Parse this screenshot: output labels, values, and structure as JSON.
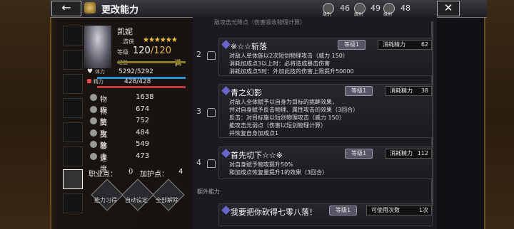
{
  "header": {
    "back_icon": "←",
    "title": "更改能力",
    "close_icon": "✕",
    "resources": [
      {
        "label": "级别",
        "value": "46"
      },
      {
        "label": "级别",
        "value": "49"
      },
      {
        "label": "级别",
        "value": "48"
      }
    ]
  },
  "character": {
    "name": "凯妮",
    "stars": "★★★★★★",
    "job_label": "游侠",
    "level_label": "等级",
    "level": "120",
    "level_max": "/120",
    "exp_label": "经验",
    "exp_max": "满",
    "hp_label": "体力",
    "hp_value": "5292/5292",
    "mp_label": "精力",
    "mp_value": "428/428"
  },
  "stats": [
    {
      "name": "物攻",
      "value": "1638"
    },
    {
      "name": "物防",
      "value": "674"
    },
    {
      "name": "属攻",
      "value": "752"
    },
    {
      "name": "属防",
      "value": "484"
    },
    {
      "name": "暴击",
      "value": "549"
    },
    {
      "name": "速度",
      "value": "473"
    }
  ],
  "points": {
    "job_label": "职业点：",
    "job_value": "0",
    "add_label": "加护点：",
    "add_value": "4"
  },
  "bottom_buttons": [
    "能力习得",
    "自动设定",
    "全部解除"
  ],
  "skills_partial": "敌攻击光降点（伤害吸收物理计算）",
  "skills": [
    {
      "num": "2",
      "name": "※☆☆斩落",
      "level_badge": "等级1",
      "cost_label": "消耗精力",
      "cost": "62",
      "desc": [
        "对敌人单体施以2次短剑物理攻击（威力 150）",
        "消耗加成点3以上时：必将造成暴击伤害",
        "消耗加成点5时：外加此技的伤害上限提升50000"
      ]
    },
    {
      "num": "3",
      "name": "青之幻影",
      "level_badge": "等级1",
      "cost_label": "消耗精力",
      "cost": "38",
      "desc": [
        "对敌人全体赋予以自身为目标的挑衅效果，",
        "并对自身赋予反击物理、属性攻击的效果（3回合）",
        "反击：对目标施以短剑物理攻击（威力 150）",
        "能攻击光弱点（伤害以短剑物理计算）",
        "并恢复自身加成点1"
      ]
    },
    {
      "num": "4",
      "name": "首先切下☆☆※",
      "level_badge": "等级1",
      "cost_label": "消耗精力",
      "cost": "112",
      "desc": [
        "对自身赋予物攻提升50%",
        "和加成点恢复量提升1的效果（3回合）"
      ]
    }
  ],
  "extra_section": "额外能力",
  "extra_skill": {
    "name": "我要把你砍得七零八落！",
    "level_badge": "等级1",
    "cost_label": "可使用次数",
    "cost": "1次"
  },
  "colors": {
    "accent_gold": "#e8b54a",
    "hp_bar": "#2d8fd6",
    "mp_bar": "#c03a3a",
    "exp_bar": "#8a7a20"
  }
}
